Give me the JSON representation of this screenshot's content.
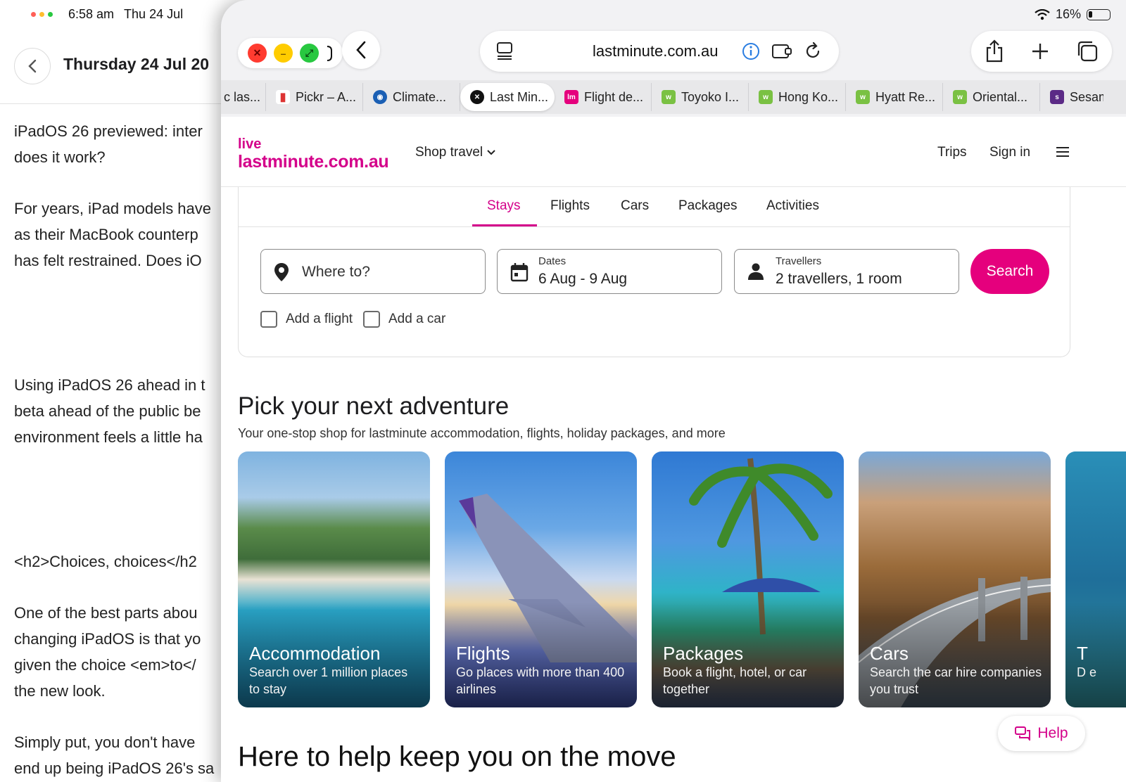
{
  "status": {
    "time": "6:58 am",
    "date": "Thu 24 Jul",
    "battery": "16%"
  },
  "notes": {
    "title": "Thursday 24 Jul 20",
    "paragraphs": [
      [
        "iPadOS 26 previewed: inter",
        "does it work?"
      ],
      [
        "For years, iPad models have",
        "as their MacBook counterp",
        "has felt restrained. Does iO"
      ],
      [
        "Using iPadOS 26 ahead in t",
        "beta ahead of the public be",
        "environment feels a little ha"
      ],
      [
        "<h2>Choices, choices</h2"
      ],
      [
        "One of the best parts abou",
        "changing iPadOS is that yo",
        "given the choice <em>to</",
        "the new look."
      ],
      [
        "Simply put, you don't have",
        "end up being iPadOS 26's sa"
      ]
    ]
  },
  "browser": {
    "url": "lastminute.com.au",
    "tabs": [
      {
        "label": "c las...",
        "icon": "",
        "color": ""
      },
      {
        "label": "Pickr – A...",
        "icon": "pickr",
        "color": "#d33"
      },
      {
        "label": "Climate...",
        "icon": "noaa",
        "color": "#1a5fb4"
      },
      {
        "label": "Last Min...",
        "icon": "close",
        "color": "#111"
      },
      {
        "label": "Flight de...",
        "icon": "lm",
        "color": "#e5007d"
      },
      {
        "label": "Toyoko I...",
        "icon": "w",
        "color": "#7ac143"
      },
      {
        "label": "Hong Ko...",
        "icon": "w",
        "color": "#7ac143"
      },
      {
        "label": "Hyatt Re...",
        "icon": "w",
        "color": "#7ac143"
      },
      {
        "label": "Oriental...",
        "icon": "w",
        "color": "#7ac143"
      },
      {
        "label": "Sesam",
        "icon": "s",
        "color": "#5b2a86"
      }
    ]
  },
  "site": {
    "logo_top": "live",
    "logo_main": "lastminute.com.au",
    "nav": {
      "shop_travel": "Shop travel",
      "trips": "Trips",
      "sign_in": "Sign in"
    },
    "lob_tabs": [
      "Stays",
      "Flights",
      "Cars",
      "Packages",
      "Activities"
    ],
    "active_tab": "Stays",
    "search": {
      "destination_placeholder": "Where to?",
      "dates_label": "Dates",
      "dates_value": "6 Aug - 9 Aug",
      "travellers_label": "Travellers",
      "travellers_value": "2 travellers, 1 room",
      "search_button": "Search",
      "add_flight": "Add a flight",
      "add_car": "Add a car"
    },
    "section": {
      "title": "Pick your next adventure",
      "subtitle": "Your one-stop shop for lastminute accommodation, flights, holiday packages, and more"
    },
    "cards": [
      {
        "title": "Accommodation",
        "desc": "Search over 1 million places to stay"
      },
      {
        "title": "Flights",
        "desc": "Go places with more than 400 airlines"
      },
      {
        "title": "Packages",
        "desc": "Book a flight, hotel, or car together"
      },
      {
        "title": "Cars",
        "desc": "Search the car hire companies you trust"
      },
      {
        "title": "T",
        "desc": "D e"
      }
    ],
    "help": "Help",
    "bottom_heading": "Here to help keep you on the move"
  },
  "colors": {
    "brand": "#e5007d",
    "brand_text": "#d4008a"
  }
}
